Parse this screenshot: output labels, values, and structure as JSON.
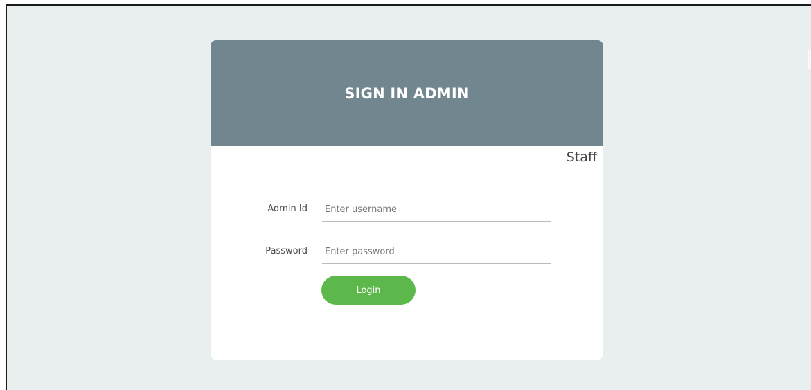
{
  "login": {
    "title": "SIGN IN ADMIN",
    "staff_link": "Staff",
    "admin_id": {
      "label": "Admin Id",
      "placeholder": "Enter username",
      "value": ""
    },
    "password": {
      "label": "Password",
      "placeholder": "Enter password",
      "value": ""
    },
    "login_button": "Login"
  },
  "colors": {
    "page_background": "#e9eeee",
    "header_background": "#728690",
    "card_background": "#ffffff",
    "button_background": "#5cb84a",
    "button_text": "#ffffff"
  }
}
